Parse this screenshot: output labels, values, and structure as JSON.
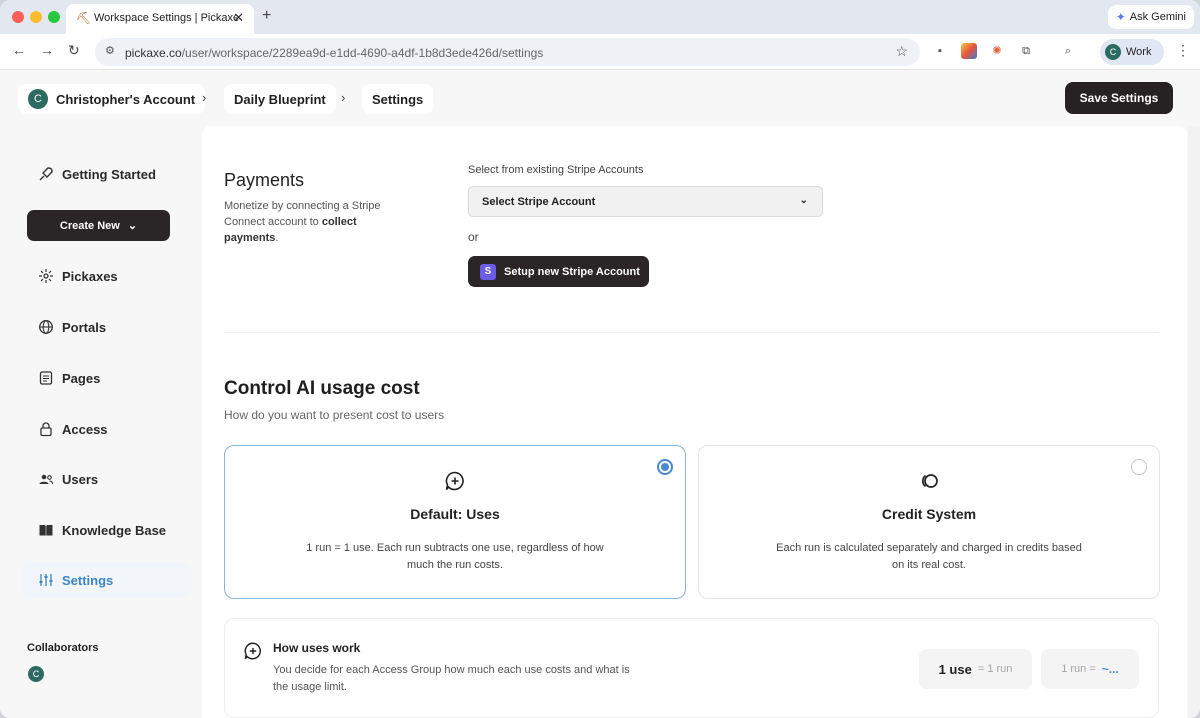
{
  "browser": {
    "tab_title": "Workspace Settings | Pickaxe",
    "tab_favicon": "pickaxe-logo",
    "url_host": "pickaxe.co",
    "url_path": "/user/workspace/2289ea9d-e1dd-4690-a4df-1b8d3ede426d/settings",
    "gemini_label": "Ask Gemini",
    "profile_initial": "C",
    "profile_label": "Work"
  },
  "breadcrumb": {
    "account_initial": "C",
    "account": "Christopher's Account",
    "workspace": "Daily Blueprint",
    "page": "Settings"
  },
  "header": {
    "save_label": "Save Settings"
  },
  "sidebar": {
    "getting_started": "Getting Started",
    "create_new": "Create New",
    "items": [
      {
        "label": "Pickaxes",
        "icon": "pickaxe-icon"
      },
      {
        "label": "Portals",
        "icon": "globe-icon"
      },
      {
        "label": "Pages",
        "icon": "page-icon"
      },
      {
        "label": "Access",
        "icon": "lock-icon"
      },
      {
        "label": "Users",
        "icon": "users-icon"
      },
      {
        "label": "Knowledge Base",
        "icon": "book-icon"
      },
      {
        "label": "Settings",
        "icon": "sliders-icon",
        "active": true
      }
    ],
    "collaborators_label": "Collaborators",
    "collaborator_initial": "C"
  },
  "payments": {
    "title": "Payments",
    "desc_prefix": "Monetize by connecting a Stripe Connect account to ",
    "desc_bold": "collect payments",
    "desc_suffix": ".",
    "select_label": "Select from existing Stripe Accounts",
    "select_value": "Select Stripe Account",
    "or": "or",
    "setup_badge": "S",
    "setup_label": "Setup new Stripe Account"
  },
  "usage_cost": {
    "title": "Control AI usage cost",
    "subtitle": "How do you want to present cost to users",
    "options": [
      {
        "title": "Default: Uses",
        "desc": "1 run = 1 use. Each run subtracts one use, regardless of how much the run costs.",
        "selected": true
      },
      {
        "title": "Credit System",
        "desc": "Each run is calculated separately and charged in credits based on its real cost.",
        "selected": false
      }
    ]
  },
  "how_uses": {
    "title": "How uses work",
    "desc": "You decide for each Access Group how much each use costs and what is the usage limit.",
    "pill1_bold": "1 use",
    "pill1_muted": "= 1 run",
    "pill2_muted": "1 run =",
    "pill2_value": "~..."
  },
  "colors": {
    "accent": "#4a88d0",
    "dark_button": "#262224",
    "stripe_purple": "#6b5ce7",
    "avatar_green": "#2d6a62"
  }
}
